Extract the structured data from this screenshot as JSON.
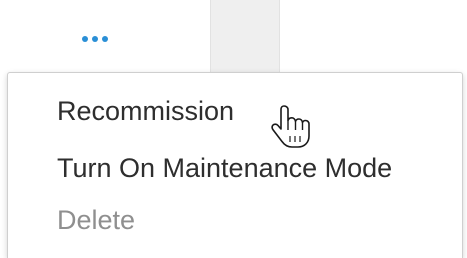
{
  "trigger": {
    "icon": "more-dots-icon",
    "color": "#2a8fd6"
  },
  "menu": {
    "items": [
      {
        "label": "Recommission",
        "enabled": true
      },
      {
        "label": "Turn On Maintenance Mode",
        "enabled": true
      },
      {
        "label": "Delete",
        "enabled": false
      }
    ]
  },
  "cursor": {
    "icon": "hand-pointer-icon"
  }
}
